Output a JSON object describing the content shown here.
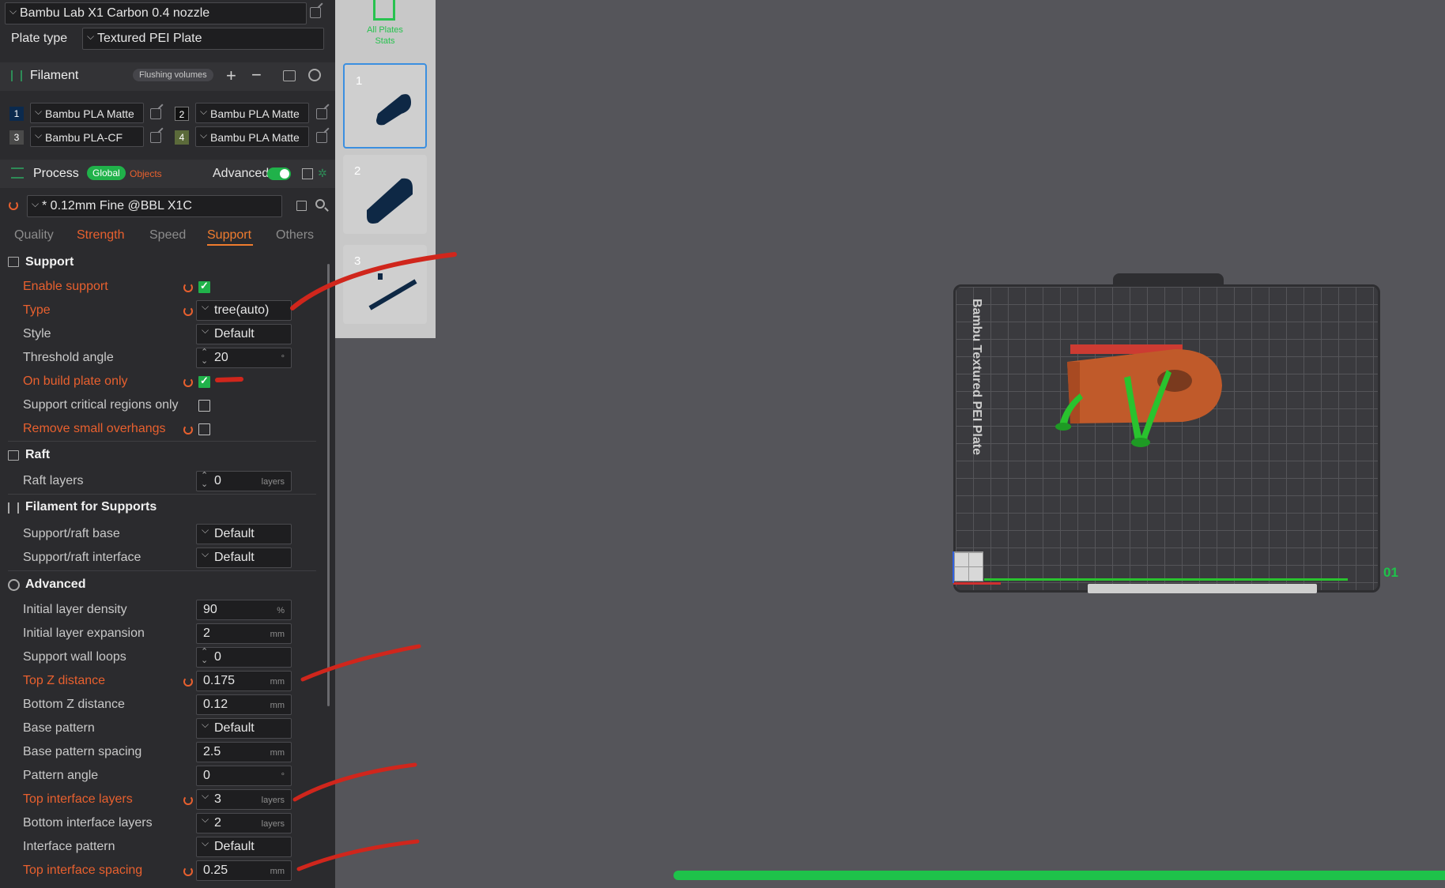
{
  "printer": {
    "name": "Bambu Lab X1 Carbon 0.4 nozzle",
    "plate_type_label": "Plate type",
    "plate_type": "Textured PEI Plate"
  },
  "filament": {
    "title": "Filament",
    "flushing_label": "Flushing volumes",
    "slots": [
      {
        "num": "1",
        "name": "Bambu PLA Matte",
        "color": "#0b2a4e"
      },
      {
        "num": "2",
        "name": "Bambu PLA Matte",
        "color": "#111111"
      },
      {
        "num": "3",
        "name": "Bambu PLA-CF",
        "color": "#4a4a4a"
      },
      {
        "num": "4",
        "name": "Bambu PLA Matte",
        "color": "#5b6a3a"
      }
    ]
  },
  "process": {
    "title": "Process",
    "global_label": "Global",
    "objects_label": "Objects",
    "advanced_label": "Advanced",
    "profile": "* 0.12mm Fine @BBL X1C"
  },
  "tabs": [
    "Quality",
    "Strength",
    "Speed",
    "Support",
    "Others"
  ],
  "support": {
    "title": "Support",
    "enable": "Enable support",
    "type_label": "Type",
    "type_value": "tree(auto)",
    "style_label": "Style",
    "style_value": "Default",
    "threshold_label": "Threshold angle",
    "threshold_value": "20",
    "threshold_unit": "°",
    "build_plate_only": "On build plate only",
    "critical_only": "Support critical regions only",
    "remove_small": "Remove small overhangs"
  },
  "raft": {
    "title": "Raft",
    "layers_label": "Raft layers",
    "layers_value": "0",
    "layers_unit": "layers"
  },
  "filament_supports": {
    "title": "Filament for Supports",
    "base_label": "Support/raft base",
    "base_value": "Default",
    "interface_label": "Support/raft interface",
    "interface_value": "Default"
  },
  "advanced": {
    "title": "Advanced",
    "rows": [
      {
        "label": "Initial layer density",
        "value": "90",
        "unit": "%"
      },
      {
        "label": "Initial layer expansion",
        "value": "2",
        "unit": "mm"
      },
      {
        "label": "Support wall loops",
        "value": "0",
        "unit": ""
      },
      {
        "label": "Top Z distance",
        "value": "0.175",
        "unit": "mm"
      },
      {
        "label": "Bottom Z distance",
        "value": "0.12",
        "unit": "mm"
      },
      {
        "label": "Base pattern",
        "value": "Default",
        "unit": ""
      },
      {
        "label": "Base pattern spacing",
        "value": "2.5",
        "unit": "mm"
      },
      {
        "label": "Pattern angle",
        "value": "0",
        "unit": "°"
      },
      {
        "label": "Top interface layers",
        "value": "3",
        "unit": "layers"
      },
      {
        "label": "Bottom interface layers",
        "value": "2",
        "unit": "layers"
      },
      {
        "label": "Interface pattern",
        "value": "Default",
        "unit": ""
      },
      {
        "label": "Top interface spacing",
        "value": "0.25",
        "unit": "mm"
      }
    ]
  },
  "plates": {
    "all_label_1": "All Plates",
    "all_label_2": "Stats",
    "items": [
      "1",
      "2",
      "3"
    ]
  },
  "bed": {
    "label": "Bambu Textured PEI Plate",
    "plate_num": "01"
  },
  "colors": {
    "accent": "#1ec24a",
    "modified": "#e8602e",
    "panel": "#2b2b2e",
    "viewport": "#55555a"
  },
  "progress": {
    "fraction": 1.0
  }
}
